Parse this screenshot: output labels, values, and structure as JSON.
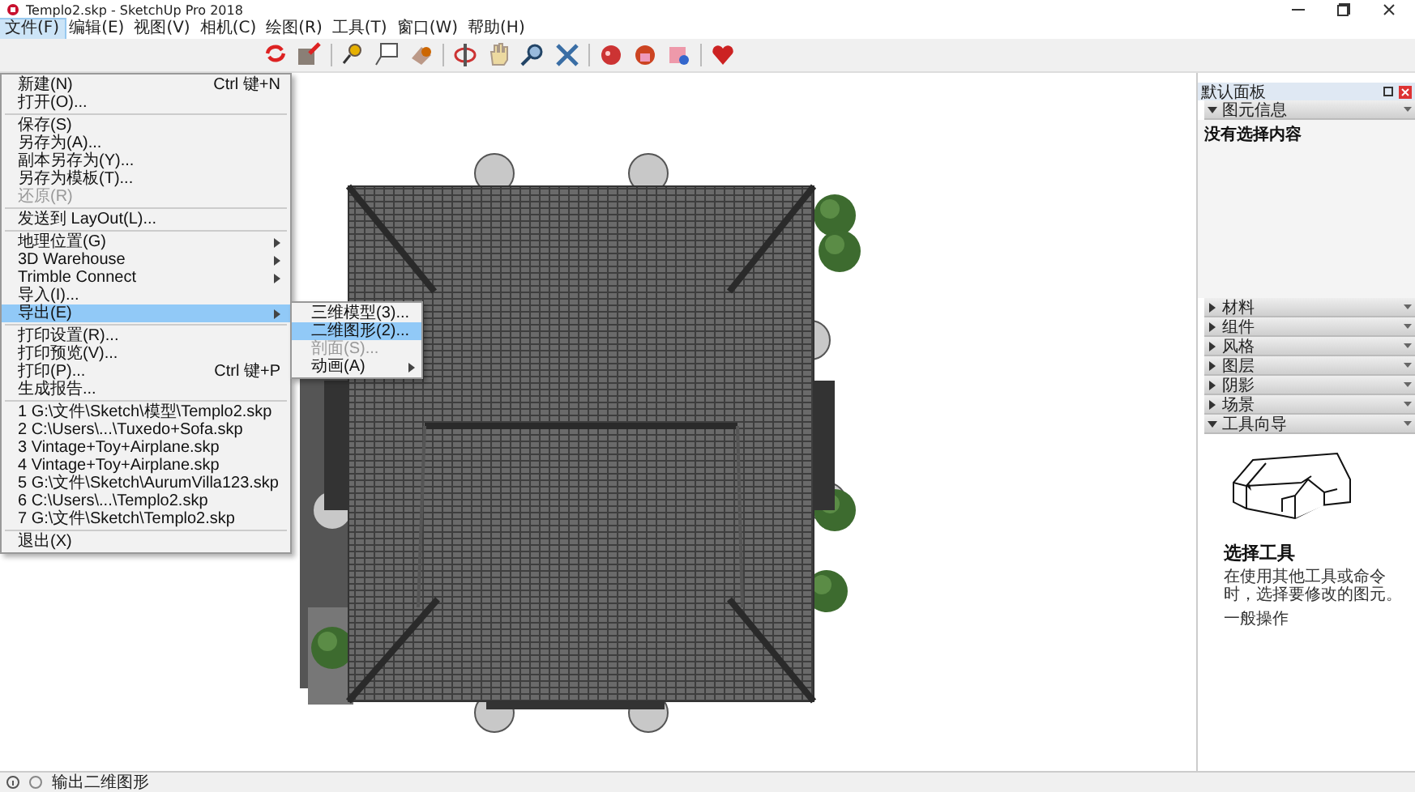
{
  "window": {
    "title": "Templo2.skp - SketchUp Pro 2018"
  },
  "menu_bar": [
    {
      "label": "文件(F)",
      "selected": true
    },
    {
      "label": "编辑(E)",
      "selected": false
    },
    {
      "label": "视图(V)",
      "selected": false
    },
    {
      "label": "相机(C)",
      "selected": false
    },
    {
      "label": "绘图(R)",
      "selected": false
    },
    {
      "label": "工具(T)",
      "selected": false
    },
    {
      "label": "窗口(W)",
      "selected": false
    },
    {
      "label": "帮助(H)",
      "selected": false
    }
  ],
  "file_menu": {
    "items": [
      {
        "kind": "item",
        "label": "新建(N)",
        "shortcut": "Ctrl 键+N",
        "selected": false,
        "disabled": false,
        "submenu": false
      },
      {
        "kind": "item",
        "label": "打开(O)...",
        "selected": false,
        "disabled": false,
        "submenu": false
      },
      {
        "kind": "separator"
      },
      {
        "kind": "item",
        "label": "保存(S)",
        "selected": false,
        "disabled": false,
        "submenu": false
      },
      {
        "kind": "item",
        "label": "另存为(A)...",
        "selected": false,
        "disabled": false,
        "submenu": false
      },
      {
        "kind": "item",
        "label": "副本另存为(Y)...",
        "selected": false,
        "disabled": false,
        "submenu": false
      },
      {
        "kind": "item",
        "label": "另存为模板(T)...",
        "selected": false,
        "disabled": false,
        "submenu": false
      },
      {
        "kind": "item",
        "label": "还原(R)",
        "selected": false,
        "disabled": true,
        "submenu": false
      },
      {
        "kind": "separator"
      },
      {
        "kind": "item",
        "label": "发送到 LayOut(L)...",
        "selected": false,
        "disabled": false,
        "submenu": false
      },
      {
        "kind": "separator"
      },
      {
        "kind": "item",
        "label": "地理位置(G)",
        "selected": false,
        "disabled": false,
        "submenu": true
      },
      {
        "kind": "item",
        "label": "3D Warehouse",
        "selected": false,
        "disabled": false,
        "submenu": true
      },
      {
        "kind": "item",
        "label": "Trimble Connect",
        "selected": false,
        "disabled": false,
        "submenu": true
      },
      {
        "kind": "item",
        "label": "导入(I)...",
        "selected": false,
        "disabled": false,
        "submenu": false
      },
      {
        "kind": "item",
        "label": "导出(E)",
        "selected": true,
        "disabled": false,
        "submenu": true
      },
      {
        "kind": "separator"
      },
      {
        "kind": "item",
        "label": "打印设置(R)...",
        "selected": false,
        "disabled": false,
        "submenu": false
      },
      {
        "kind": "item",
        "label": "打印预览(V)...",
        "selected": false,
        "disabled": false,
        "submenu": false
      },
      {
        "kind": "item",
        "label": "打印(P)...",
        "shortcut": "Ctrl 键+P",
        "selected": false,
        "disabled": false,
        "submenu": false
      },
      {
        "kind": "item",
        "label": "生成报告...",
        "selected": false,
        "disabled": false,
        "submenu": false
      },
      {
        "kind": "separator"
      },
      {
        "kind": "item",
        "label": "1 G:\\文件\\Sketch\\模型\\Templo2.skp",
        "selected": false,
        "disabled": false,
        "submenu": false
      },
      {
        "kind": "item",
        "label": "2 C:\\Users\\...\\Tuxedo+Sofa.skp",
        "selected": false,
        "disabled": false,
        "submenu": false
      },
      {
        "kind": "item",
        "label": "3 Vintage+Toy+Airplane.skp",
        "selected": false,
        "disabled": false,
        "submenu": false
      },
      {
        "kind": "item",
        "label": "4 Vintage+Toy+Airplane.skp",
        "selected": false,
        "disabled": false,
        "submenu": false
      },
      {
        "kind": "item",
        "label": "5 G:\\文件\\Sketch\\AurumVilla123.skp",
        "selected": false,
        "disabled": false,
        "submenu": false
      },
      {
        "kind": "item",
        "label": "6 C:\\Users\\...\\Templo2.skp",
        "selected": false,
        "disabled": false,
        "submenu": false
      },
      {
        "kind": "item",
        "label": "7 G:\\文件\\Sketch\\Templo2.skp",
        "selected": false,
        "disabled": false,
        "submenu": false
      },
      {
        "kind": "separator"
      },
      {
        "kind": "item",
        "label": "退出(X)",
        "selected": false,
        "disabled": false,
        "submenu": false
      }
    ]
  },
  "export_submenu": {
    "items": [
      {
        "label": "三维模型(3)...",
        "selected": false,
        "disabled": false,
        "submenu": false
      },
      {
        "label": "二维图形(2)...",
        "selected": true,
        "disabled": false,
        "submenu": false
      },
      {
        "label": "剖面(S)...",
        "selected": false,
        "disabled": true,
        "submenu": false
      },
      {
        "label": "动画(A)",
        "selected": false,
        "disabled": false,
        "submenu": true
      }
    ]
  },
  "tray": {
    "title": "默认面板",
    "sections": [
      {
        "kind": "entity_info",
        "title": "图元信息",
        "expanded": true,
        "content": "没有选择内容"
      },
      {
        "title": "材料",
        "expanded": false
      },
      {
        "title": "组件",
        "expanded": false
      },
      {
        "title": "风格",
        "expanded": false
      },
      {
        "title": "图层",
        "expanded": false
      },
      {
        "title": "阴影",
        "expanded": false
      },
      {
        "title": "场景",
        "expanded": false
      },
      {
        "kind": "instructor",
        "title": "工具向导",
        "expanded": true,
        "tool_name": "选择工具",
        "description": "在使用其他工具或命令时，选择要修改的图元。",
        "subheading": "一般操作"
      }
    ]
  },
  "status_bar": {
    "message": "输出二维图形"
  }
}
